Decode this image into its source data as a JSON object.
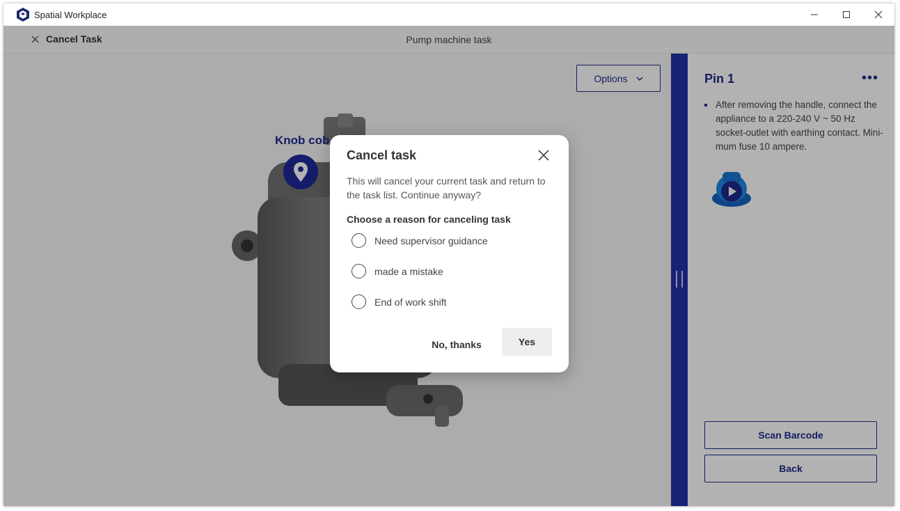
{
  "window": {
    "title": "Spatial Workplace"
  },
  "topbar": {
    "cancel_label": "Cancel Task",
    "task_title": "Pump machine task"
  },
  "viewport": {
    "options_label": "Options",
    "pin_label": "Knob cob"
  },
  "sidepanel": {
    "pin_title": "Pin 1",
    "instruction": "After removing the handle, connect the appliance to a 220-240 V ~ 50 Hz socket-outlet with earthing contact. Mini-mum fuse 10 ampere.",
    "scan_label": "Scan Barcode",
    "back_label": "Back"
  },
  "dialog": {
    "title": "Cancel task",
    "message": "This will cancel your current task and return to the task list. Continue anyway?",
    "reason_heading": "Choose a reason for canceling task",
    "reasons": [
      "Need supervisor guidance",
      "made a mistake",
      "End of work shift"
    ],
    "no_label": "No, thanks",
    "yes_label": "Yes"
  },
  "colors": {
    "accent": "#1f2a8a",
    "divider": "#2132a8"
  }
}
